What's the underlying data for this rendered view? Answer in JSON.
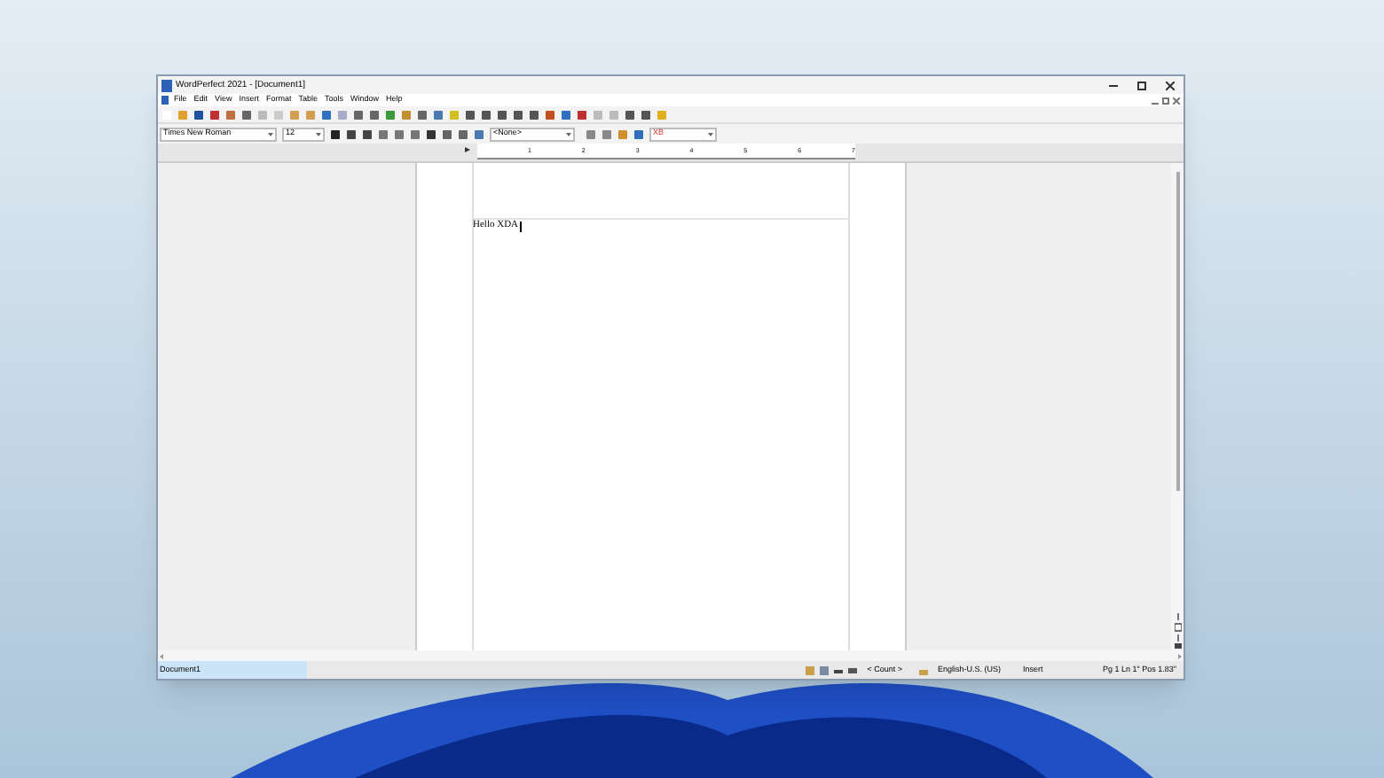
{
  "window": {
    "title": "WordPerfect 2021 - [Document1]"
  },
  "menu": [
    "File",
    "Edit",
    "View",
    "Insert",
    "Format",
    "Table",
    "Tools",
    "Window",
    "Help"
  ],
  "property_bar": {
    "font": "Times New Roman",
    "size": "12",
    "style": "<None>",
    "field": "XB"
  },
  "ruler": {
    "marks": [
      "1",
      "2",
      "3",
      "4",
      "5",
      "6",
      "7"
    ]
  },
  "document": {
    "text": "Hello XDA"
  },
  "status_bar": {
    "document": "Document1",
    "count": "< Count >",
    "language": "English-U.S. (US)",
    "mode": "Insert",
    "position": "Pg 1 Ln 1\" Pos 1.83\""
  }
}
